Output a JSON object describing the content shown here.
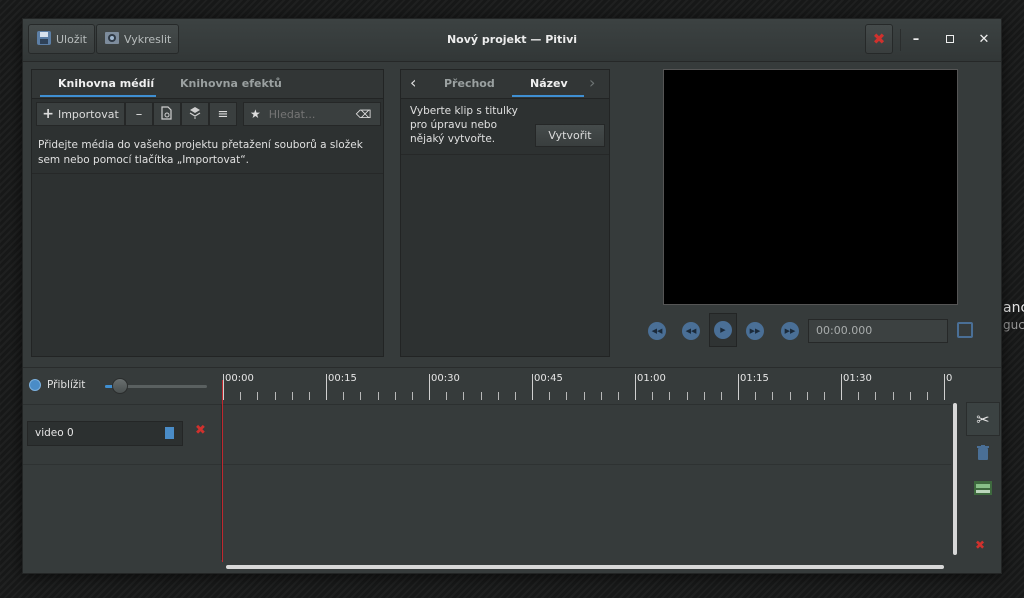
{
  "background": {
    "partial_text_1": "anc",
    "partial_text_2": "guc"
  },
  "headerbar": {
    "save_label": "Uložit",
    "render_label": "Vykreslit",
    "title": "Nový projekt — Pitivi"
  },
  "media_library": {
    "tabs": [
      "Knihovna médií",
      "Knihovna efektů"
    ],
    "import_label": "Importovat",
    "search_placeholder": "Hledat...",
    "hint": "Přidejte média do vašeho projektu přetažení souborů a složek sem nebo pomocí tlačítka „Importovat“."
  },
  "clip_panel": {
    "tabs": [
      "Přechod",
      "Název"
    ],
    "hint": "Vyberte klip s titulky pro úpravu nebo nějaký vytvořte.",
    "create_label": "Vytvořit"
  },
  "viewer": {
    "timecode": "00:00.000"
  },
  "timeline": {
    "zoom_label": "Přiblížit",
    "zoom_level": 0.15,
    "ruler_labels": [
      "00:00",
      "00:15",
      "00:30",
      "00:45",
      "01:00",
      "01:15",
      "01:30",
      "0"
    ],
    "layer_name": "video 0"
  },
  "colors": {
    "accent": "#3f8fd2",
    "playhead": "#c0282f",
    "close_red": "#cc2c2c"
  }
}
